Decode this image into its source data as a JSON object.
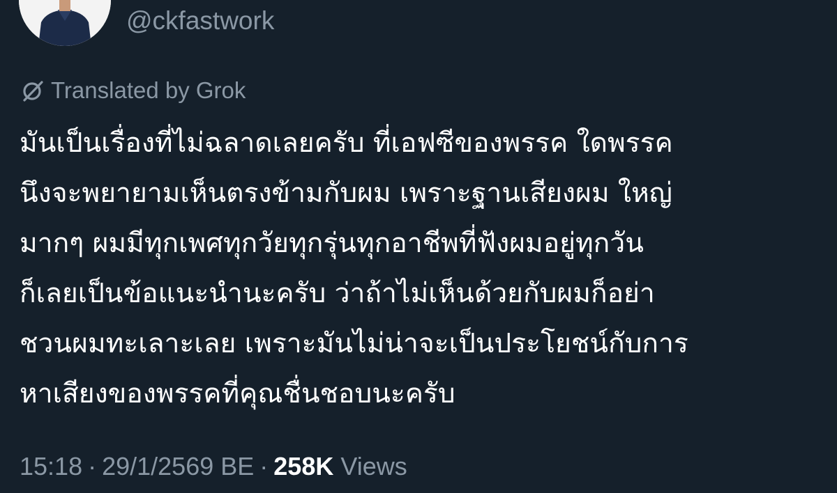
{
  "author": {
    "handle": "@ckfastwork"
  },
  "translation": {
    "label": "Translated by Grok",
    "icon": "grok-icon"
  },
  "tweet": {
    "lines": [
      "มันเป็นเรื่องที่ไม่ฉลาดเลยครับ ที่เอฟซีของพรรค ใดพรรค",
      "นึงจะพยายามเห็นตรงข้ามกับผม เพราะฐานเสียงผม ใหญ่",
      "มากๆ ผมมีทุกเพศทุกวัยทุกรุ่นทุกอาชีพที่ฟังผมอยู่ทุกวัน",
      "ก็เลยเป็นข้อแนะนำนะครับ ว่าถ้าไม่เห็นด้วยกับผมก็อย่า",
      "ชวนผมทะเลาะเลย เพราะมันไม่น่าจะเป็นประโยชน์กับการ",
      "หาเสียงของพรรคที่คุณชื่นชอบนะครับ"
    ]
  },
  "meta": {
    "time": "15:18",
    "separator": "·",
    "date": "29/1/2569 BE",
    "views_count": "258K",
    "views_label": "Views"
  },
  "colors": {
    "background": "#15202b",
    "text": "#ffffff",
    "secondary_text": "#8b98a5"
  }
}
